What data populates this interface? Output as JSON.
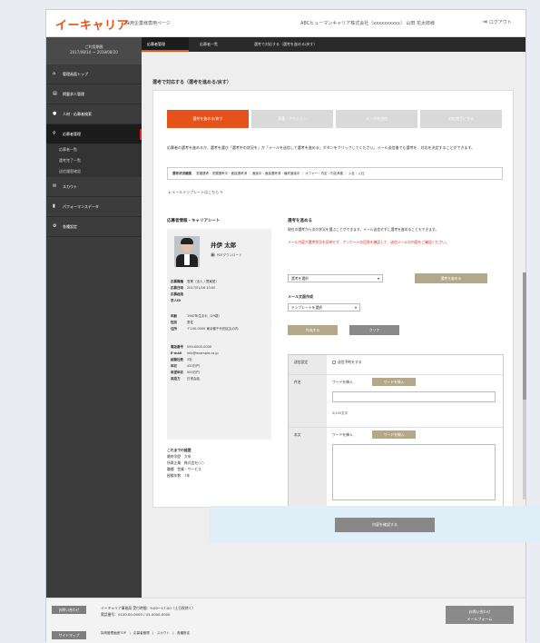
{
  "app": {
    "logo": "イーキャリア",
    "subtitle": "採用企業様専用ページ",
    "account": "ABCヒューマンキャリア株式会社（xxxxxxxxxx） 山田 花太郎様",
    "logout_label": "ログアウト"
  },
  "sidebar": {
    "date_line1": "ご利用期間",
    "date_line2": "2017/08/14 〜 2018/08/20",
    "items": [
      {
        "icon": "home-icon",
        "label": "管理画面トップ"
      },
      {
        "icon": "doc-icon",
        "label": "掲載求人管理"
      },
      {
        "icon": "search-icon",
        "label": "人材・応募者検索"
      },
      {
        "icon": "person-icon",
        "label": "応募者管理"
      }
    ],
    "sub_items": [
      "応募者一覧",
      "選考完了一覧",
      "送信履歴確認"
    ],
    "items2": [
      {
        "icon": "mail-icon",
        "label": "スカウト"
      },
      {
        "icon": "chart-icon",
        "label": "パフォーマンスデータ"
      },
      {
        "icon": "gear-icon",
        "label": "各種設定"
      }
    ]
  },
  "tabs": [
    "応募者管理",
    "応募者一覧",
    "選考で対応する（選考を進める/戻す）"
  ],
  "main": {
    "heading": "選考で対応する（選考を進める/戻す）",
    "steps": [
      "選考を進める/戻す",
      "再選・アクション",
      "メールを送信",
      "対応完了にする"
    ],
    "desc": "応募者の選考を進めるか、選考を選び「選考中の状況を」か「メールを送信して選考を進める」ボタンをクリックしてください。メール送信後でも選考を、対応を決定することができます。",
    "filters_label": "選考状況確認",
    "filters": [
      "書類選考・書類選考中・面接選考済",
      "面接中・面接選考済・最終面接中",
      "オファー・内定・内定承諾",
      "入社・入社"
    ],
    "mail_tip": "メールテンプレートはこちら"
  },
  "profile": {
    "title": "応募者情報・キャリアシート",
    "name": "井伊 太郎",
    "download_label": "PDFダウンロード",
    "rows": [
      {
        "k": "応募職種",
        "v": "営業（法人 / 提案型）"
      },
      {
        "k": "応募日時",
        "v": "2017/01/16 10:00"
      },
      {
        "k": "応募経路",
        "v": ""
      },
      {
        "k": "求人ID",
        "v": ""
      },
      {
        "k": "年齢",
        "v": "1987年生まれ（29歳）"
      },
      {
        "k": "性別",
        "v": "男性"
      },
      {
        "k": "住所",
        "v": "〒100-0000 東京都千代田区丸の内"
      },
      {
        "k": "電話番号",
        "v": "090-0000-0000"
      },
      {
        "k": "E-mail",
        "v": "info@example.co.jp"
      },
      {
        "k": "経験社数",
        "v": "3社"
      },
      {
        "k": "年収",
        "v": "450万円"
      },
      {
        "k": "希望年収",
        "v": "500万円"
      },
      {
        "k": "英語力",
        "v": "日常会話"
      }
    ],
    "footer_title": "これまでの経歴",
    "footer_rows": [
      "最終学歴　大卒",
      "所属企業　株式会社○○",
      "職種　営業・サービス",
      "経験年数　7年"
    ]
  },
  "form": {
    "title": "選考を進める",
    "desc": "現在の選考から次の状況を選ぶことができます。メール送信せずに選考を進めることもできます。",
    "warn": "メール内容が選考状況を反映せず、アンケートの回答を確認して、送信メールの内容をご確認ください。",
    "stage_select": "選考を選択",
    "stage_button": "選考を進める",
    "template_label": "メール文面作成",
    "template_select": "テンプレートを選択",
    "create_button": "作成する",
    "clear_button": "クリア",
    "row1_label": "送信設定",
    "row1_value": "送信予約をする",
    "row2_label": "件名",
    "row2_value": "ワードを挿入",
    "row2_button": "ワードを挿入",
    "row2_hint": "0/100文字",
    "row3_label": "本文",
    "row3_value": "ワードを挿入",
    "row3_button": "ワードを挿入"
  },
  "confirm_button": "内容を確認する",
  "footer": {
    "tag1": "お問い合わせ",
    "info1": "イーキャリア事務局 受付時間：9:00〜17:00（土日祝除く）",
    "info2": "電話番号：0120-00-0000 / 03-0000-0000",
    "tag2": "サイトマップ",
    "links": "採用管理画面TOP　|　応募者管理　|　スカウト　|　各種設定",
    "contact_line1": "お問い合わせ",
    "contact_line2": "メールフォーム"
  }
}
